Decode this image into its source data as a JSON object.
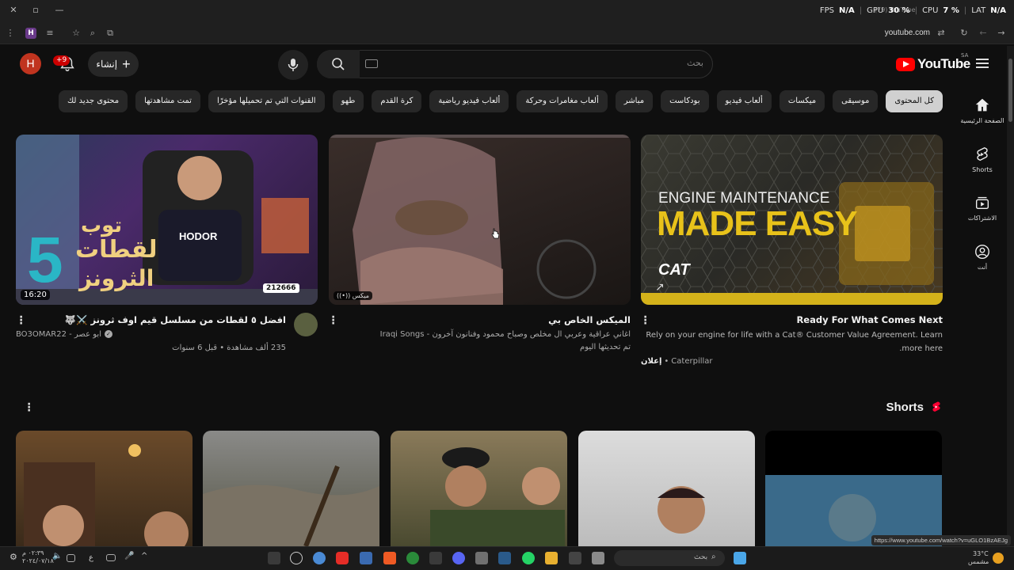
{
  "overlay": {
    "fps_label": "FPS",
    "fps_value": "N/A",
    "gpu_label": "GPU",
    "gpu_value": "30 %",
    "cpu_label": "CPU",
    "cpu_value": "7 %",
    "lat_label": "LAT",
    "lat_value": "N/A",
    "tab_title": "(79) YouTube"
  },
  "browser": {
    "url": "youtube.com",
    "profile_letter": "H"
  },
  "header": {
    "avatar_letter": "H",
    "notification_count": "+9",
    "create_label": "إنشاء",
    "search_placeholder": "بحث",
    "logo_text": "YouTube",
    "country_code": "SA"
  },
  "chips": [
    {
      "label": "كل المحتوى",
      "active": true
    },
    {
      "label": "موسيقى"
    },
    {
      "label": "ميكسات"
    },
    {
      "label": "ألعاب فيديو"
    },
    {
      "label": "بودكاست"
    },
    {
      "label": "مباشر"
    },
    {
      "label": "ألعاب مغامرات وحركة"
    },
    {
      "label": "ألعاب فيديو رياضية"
    },
    {
      "label": "كرة القدم"
    },
    {
      "label": "طهو"
    },
    {
      "label": "القنوات التي تم تحميلها مؤخرًا"
    },
    {
      "label": "تمت مشاهدتها"
    },
    {
      "label": "محتوى جديد لك"
    }
  ],
  "sidebar": [
    {
      "label": "الصفحة الرئيسية",
      "icon": "home-icon"
    },
    {
      "label": "Shorts",
      "icon": "shorts-icon"
    },
    {
      "label": "الاشتراكات",
      "icon": "subscriptions-icon"
    },
    {
      "label": "أنت",
      "icon": "you-icon"
    }
  ],
  "videos": [
    {
      "title": "Ready For What Comes Next",
      "description": "Rely on your engine for life with a Cat® Customer Value Agreement. Learn more here.",
      "ad_label": "إعلان",
      "channel": "Caterpillar",
      "thumb_text_1": "ENGINE MAINTENANCE",
      "thumb_text_2": "MADE EASY",
      "thumb_logo": "CAT"
    },
    {
      "title": "الميكس الخاص بي",
      "channel": "اغاني عراقية وعربي ال مخلص وصباح محمود وفنانون آخرون - Iraqi Songs",
      "meta": "تم تحديثها اليوم",
      "badge": "ميكس"
    },
    {
      "title": "افضل ٥ لقطات من مسلسل قيم اوف ثرونز ⚔️🐺",
      "channel": "ابو عصر - BO3OMAR22",
      "meta": "235 ألف مشاهدة • قبل 6 سنوات",
      "duration": "16:20",
      "thumb_text_1": "توب",
      "thumb_text_2": "لقطات",
      "thumb_text_3": "الثرونز",
      "thumb_number": "5",
      "thumb_chair": "HODOR",
      "thumb_views": "212666"
    }
  ],
  "shorts": {
    "title": "Shorts"
  },
  "status": {
    "hover_url": "https://www.youtube.com/watch?v=uGLO1BzAEJg",
    "search_placeholder": "بحث",
    "weather_temp": "33°C",
    "weather_desc": "مشمس",
    "clock_time": "٠٢:٣٩ م",
    "clock_date": "٢٠٢٤/٠٧/١٨",
    "lang": "ع"
  },
  "colors": {
    "accent_red": "#ff0000",
    "cat_yellow": "#f4c21a",
    "background": "#0f0f0f"
  }
}
